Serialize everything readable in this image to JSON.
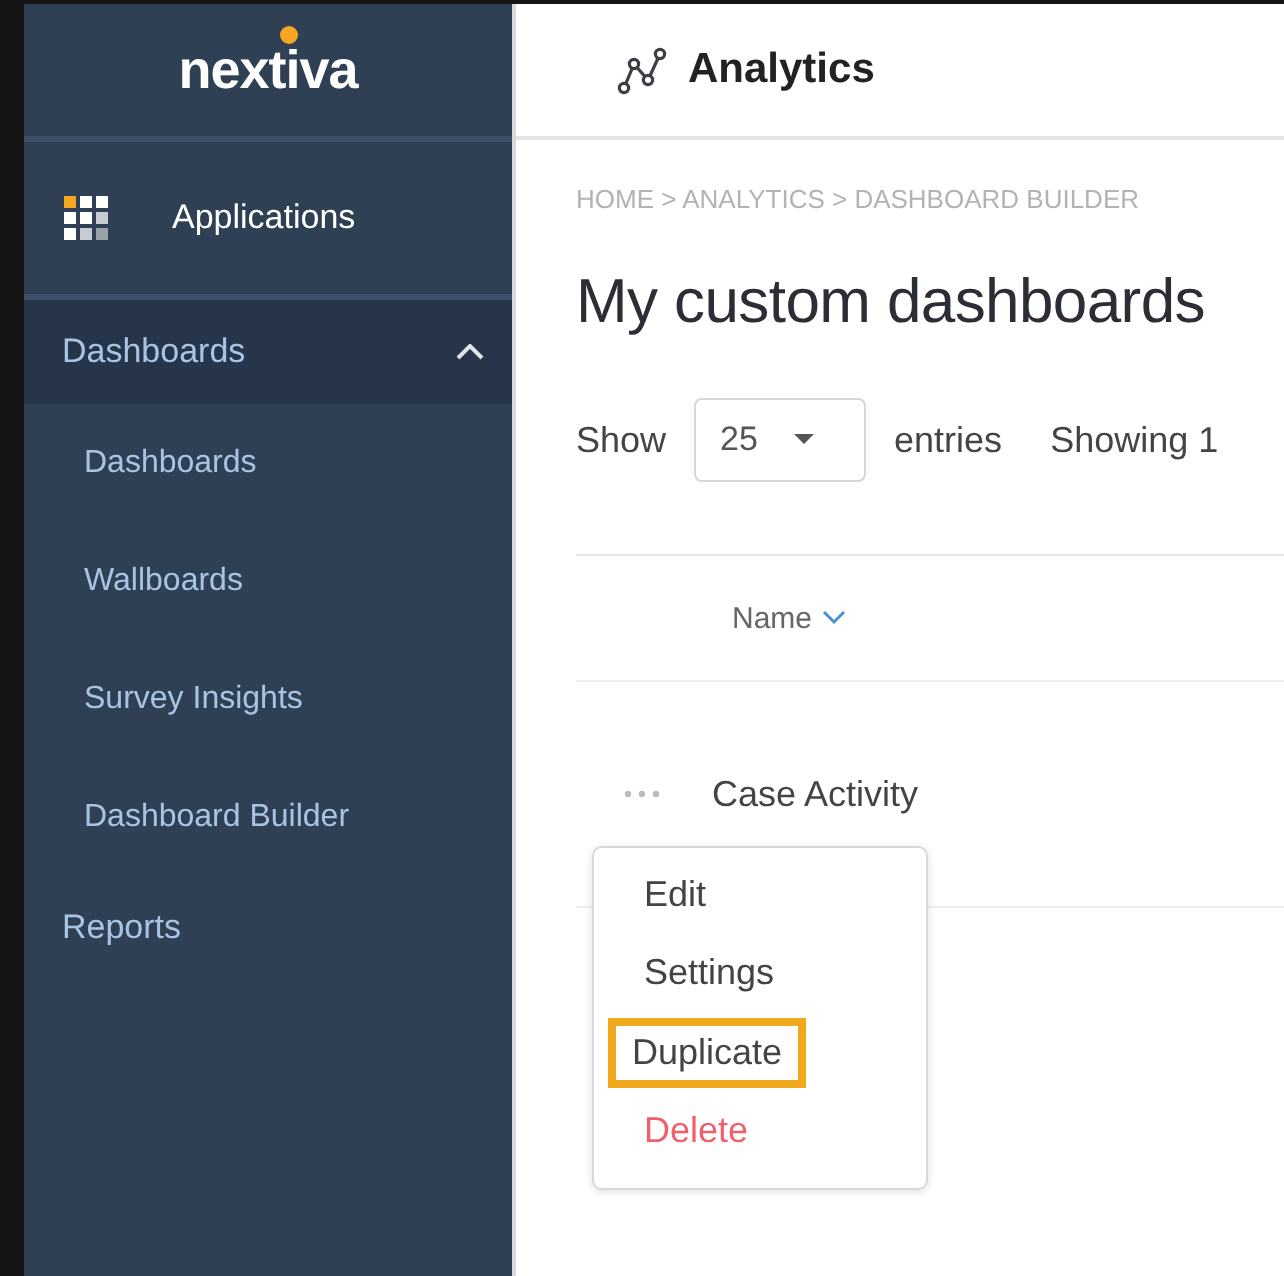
{
  "logo": {
    "text": "nextiva"
  },
  "app": {
    "title": "Analytics"
  },
  "sidebar": {
    "items": [
      {
        "kind": "apps",
        "label": "Applications"
      },
      {
        "kind": "section",
        "label": "Dashboards",
        "expanded": true,
        "children": [
          {
            "label": "Dashboards"
          },
          {
            "label": "Wallboards"
          },
          {
            "label": "Survey Insights"
          },
          {
            "label": "Dashboard Builder"
          }
        ]
      },
      {
        "kind": "section",
        "label": "Reports",
        "expanded": false
      }
    ]
  },
  "breadcrumb": "HOME > ANALYTICS > DASHBOARD BUILDER",
  "page_title": "My custom dashboards",
  "entries_control": {
    "show_label": "Show",
    "value": "25",
    "entries_label": "entries",
    "info": "Showing 1"
  },
  "table": {
    "columns": [
      {
        "label": "Name",
        "sorted": true
      }
    ],
    "rows": [
      {
        "name": "Case Activity"
      }
    ]
  },
  "row_menu": {
    "items": [
      {
        "label": "Edit",
        "kind": "normal",
        "highlighted": false
      },
      {
        "label": "Settings",
        "kind": "normal",
        "highlighted": false
      },
      {
        "label": "Duplicate",
        "kind": "normal",
        "highlighted": true
      },
      {
        "label": "Delete",
        "kind": "danger",
        "highlighted": false
      }
    ]
  }
}
